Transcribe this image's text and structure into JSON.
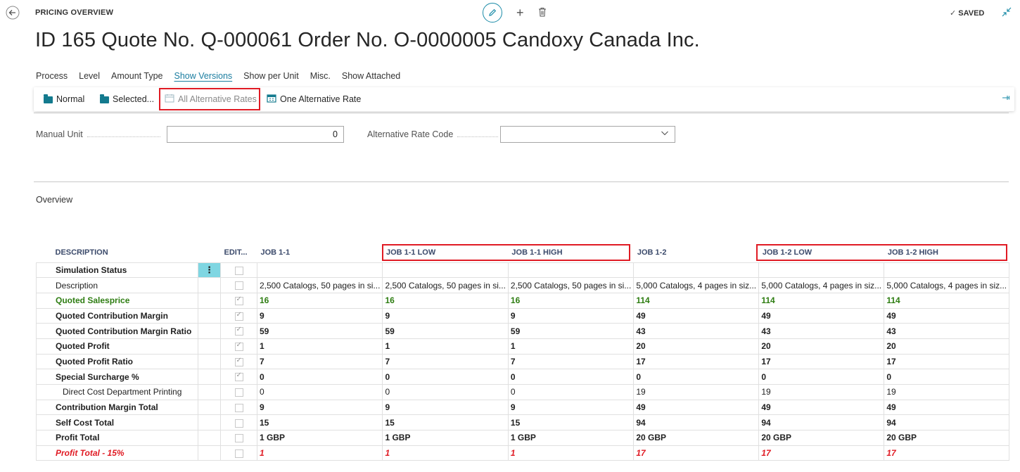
{
  "header": {
    "caption": "PRICING OVERVIEW",
    "saved": "SAVED",
    "saved_check": "✓",
    "title": "ID 165 Quote No. Q-000061 Order No. O-0000005 Candoxy Canada Inc."
  },
  "menu": [
    {
      "label": "Process"
    },
    {
      "label": "Level"
    },
    {
      "label": "Amount Type"
    },
    {
      "label": "Show Versions",
      "active": true
    },
    {
      "label": "Show per Unit"
    },
    {
      "label": "Misc."
    },
    {
      "label": "Show Attached"
    }
  ],
  "actionbar": {
    "normal": "Normal",
    "selected": "Selected...",
    "all_alt": "All Alternative Rates",
    "one_alt": "One Alternative Rate"
  },
  "fields": {
    "manual_unit_label": "Manual Unit",
    "manual_unit_value": "0",
    "alt_rate_label": "Alternative Rate Code",
    "alt_rate_value": ""
  },
  "overview_label": "Overview",
  "table": {
    "headers": {
      "description": "DESCRIPTION",
      "edit": "EDIT...",
      "job11": "JOB 1-1",
      "job11low": "JOB 1-1 LOW",
      "job11high": "JOB 1-1 HIGH",
      "job12": "JOB 1-2",
      "job12low": "JOB 1-2 LOW",
      "job12high": "JOB 1-2 HIGH"
    },
    "rows": [
      {
        "label": "Simulation Status",
        "style": "bold",
        "editable": false,
        "values": [
          "",
          "",
          "",
          "",
          "",
          ""
        ]
      },
      {
        "label": "Description",
        "style": "normal",
        "editable": false,
        "values": [
          "2,500 Catalogs, 50 pages in si...",
          "2,500 Catalogs, 50 pages in si...",
          "2,500 Catalogs, 50 pages in si...",
          "5,000 Catalogs, 4 pages in siz...",
          "5,000 Catalogs, 4 pages in siz...",
          "5,000 Catalogs, 4 pages in siz..."
        ]
      },
      {
        "label": "Quoted Salesprice",
        "style": "green",
        "editable": true,
        "values": [
          "16",
          "16",
          "16",
          "114",
          "114",
          "114"
        ]
      },
      {
        "label": "Quoted Contribution Margin",
        "style": "bold",
        "editable": true,
        "values": [
          "9",
          "9",
          "9",
          "49",
          "49",
          "49"
        ]
      },
      {
        "label": "Quoted Contribution Margin Ratio",
        "style": "bold",
        "editable": true,
        "values": [
          "59",
          "59",
          "59",
          "43",
          "43",
          "43"
        ]
      },
      {
        "label": "Quoted Profit",
        "style": "bold",
        "editable": true,
        "values": [
          "1",
          "1",
          "1",
          "20",
          "20",
          "20"
        ]
      },
      {
        "label": "Quoted Profit Ratio",
        "style": "bold",
        "editable": true,
        "values": [
          "7",
          "7",
          "7",
          "17",
          "17",
          "17"
        ]
      },
      {
        "label": "Special Surcharge %",
        "style": "bold",
        "editable": true,
        "values": [
          "0",
          "0",
          "0",
          "0",
          "0",
          "0"
        ]
      },
      {
        "label": "Direct Cost Department Printing",
        "style": "indent",
        "editable": false,
        "values": [
          "0",
          "0",
          "0",
          "19",
          "19",
          "19"
        ]
      },
      {
        "label": "Contribution Margin Total",
        "style": "bold",
        "editable": false,
        "values": [
          "9",
          "9",
          "9",
          "49",
          "49",
          "49"
        ]
      },
      {
        "label": "Self Cost Total",
        "style": "bold",
        "editable": false,
        "values": [
          "15",
          "15",
          "15",
          "94",
          "94",
          "94"
        ]
      },
      {
        "label": "Profit Total",
        "style": "bold",
        "editable": false,
        "values": [
          "1 GBP",
          "1 GBP",
          "1 GBP",
          "20 GBP",
          "20 GBP",
          "20 GBP"
        ]
      },
      {
        "label": "Profit Total - 15%",
        "style": "red",
        "editable": false,
        "values": [
          "1",
          "1",
          "1",
          "17",
          "17",
          "17"
        ]
      }
    ]
  }
}
